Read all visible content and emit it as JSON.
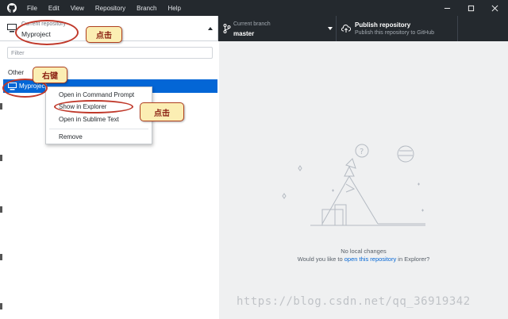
{
  "menu": [
    "File",
    "Edit",
    "View",
    "Repository",
    "Branch",
    "Help"
  ],
  "toolbar": {
    "repo_label": "Current repository",
    "repo_name": "Myproject",
    "branch_label": "Current branch",
    "branch_name": "master",
    "publish_title": "Publish repository",
    "publish_desc": "Publish this repository to GitHub"
  },
  "sidebar": {
    "filter_placeholder": "Filter",
    "group_label": "Other",
    "selected_repo": "Myproject"
  },
  "context_menu": {
    "items": [
      "Open in Command Prompt",
      "Show in Explorer",
      "Open in Sublime Text",
      "Remove"
    ]
  },
  "empty_state": {
    "title": "No local changes",
    "prefix": "Would you like to ",
    "link": "open this repository",
    "suffix": " in Explorer?"
  },
  "annotations": {
    "click_1": "点击",
    "right_click": "右键",
    "click_2": "点击"
  },
  "watermark": "https://blog.csdn.net/qq_36919342",
  "colors": {
    "title_bar": "#24292e",
    "selection": "#0366d6",
    "right_pane": "#eff0f1",
    "annotation_stroke": "#c0392b",
    "annotation_fill": "#fbeeb3"
  }
}
